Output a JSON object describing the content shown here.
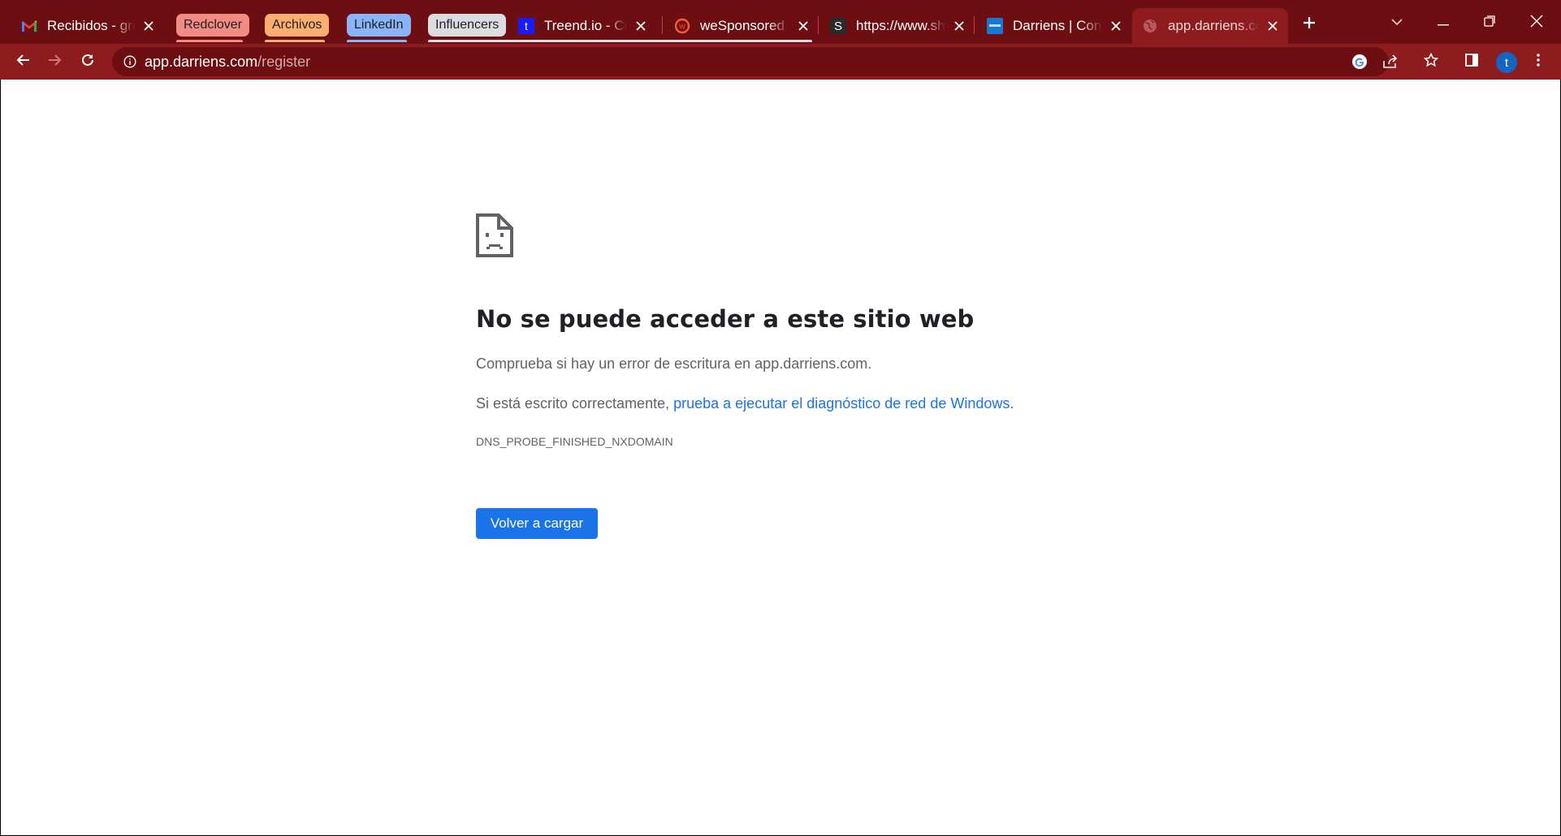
{
  "colors": {
    "frame": "#6d0f12",
    "toolbar": "#8e1b1e",
    "link": "#1a73e8",
    "button": "#1a73e8"
  },
  "tabs": [
    {
      "title": "Recibidos - grimt",
      "icon": "gmail-icon"
    },
    {
      "title": "Treend.io - Colab",
      "icon": "treend-icon"
    },
    {
      "title": "weSponsored",
      "icon": "wesponsored-icon"
    },
    {
      "title": "https://www.show",
      "icon": "showcase-s-icon"
    },
    {
      "title": "Darriens | Contác",
      "icon": "darriens-icon"
    },
    {
      "title": "app.darriens.com",
      "icon": "globe-icon",
      "active": true
    }
  ],
  "tab_groups": [
    {
      "label": "Redclover",
      "color": "#f28b82"
    },
    {
      "label": "Archivos",
      "color": "#fcad70"
    },
    {
      "label": "LinkedIn",
      "color": "#8ab4f8"
    },
    {
      "label": "Influencers",
      "color": "#dadce0"
    }
  ],
  "address_bar": {
    "host": "app.darriens.com",
    "path": "/register"
  },
  "profile": {
    "initial": "t"
  },
  "error_page": {
    "title": "No se puede acceder a este sitio web",
    "line1": "Comprueba si hay un error de escritura en app.darriens.com.",
    "line2_prefix": "Si está escrito correctamente, ",
    "line2_link": "prueba a ejecutar el diagnóstico de red de Windows",
    "line2_suffix": ".",
    "error_code": "DNS_PROBE_FINISHED_NXDOMAIN",
    "reload_button": "Volver a cargar"
  }
}
